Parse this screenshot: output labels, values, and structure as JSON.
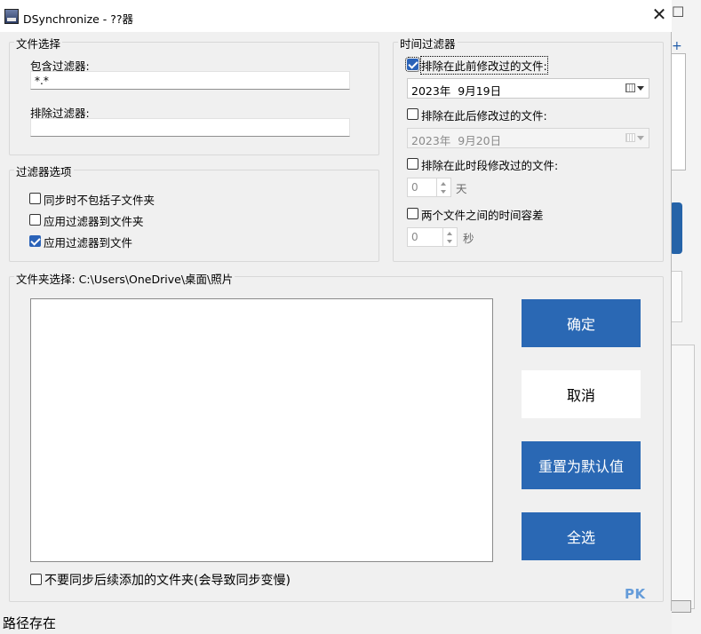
{
  "window": {
    "title": "DSynchronize - ??器"
  },
  "file_selection": {
    "legend": "文件选择",
    "include_label": "包含过滤器:",
    "include_value": "*.*",
    "exclude_label": "排除过滤器:",
    "exclude_value": ""
  },
  "filter_options": {
    "legend": "过滤器选项",
    "items": [
      {
        "label": "同步时不包括子文件夹",
        "checked": false
      },
      {
        "label": "应用过滤器到文件夹",
        "checked": false
      },
      {
        "label": "应用过滤器到文件",
        "checked": true
      }
    ]
  },
  "time_filter": {
    "legend": "时间过滤器",
    "before_label": "排除在此前修改过的文件:",
    "before_checked": true,
    "before_date": "2023年  9月19日",
    "after_label": "排除在此后修改过的文件:",
    "after_checked": false,
    "after_date": "2023年  9月20日",
    "period_label": "排除在此时段修改过的文件:",
    "period_checked": false,
    "period_value": "0",
    "period_unit": "天",
    "tolerance_label": "两个文件之间的时间容差",
    "tolerance_checked": false,
    "tolerance_value": "0",
    "tolerance_unit": "秒"
  },
  "folder_selection": {
    "legend": "文件夹选择: C:\\Users\\OneDrive\\桌面\\照片",
    "no_sync_label": "不要同步后续添加的文件夹(会导致同步变慢)",
    "no_sync_checked": false
  },
  "buttons": {
    "ok": "确定",
    "cancel": "取消",
    "reset": "重置为默认值",
    "select_all": "全选"
  },
  "status_bar": {
    "text": "路径存在"
  },
  "watermark": {
    "text": "PK"
  },
  "colors": {
    "accent": "#2a68b4",
    "checkbox_on": "#2b63b8"
  },
  "icons": [
    "app-icon",
    "close-icon",
    "calendar-icon",
    "dropdown-arrow-icon",
    "spin-up-icon",
    "spin-down-icon"
  ]
}
